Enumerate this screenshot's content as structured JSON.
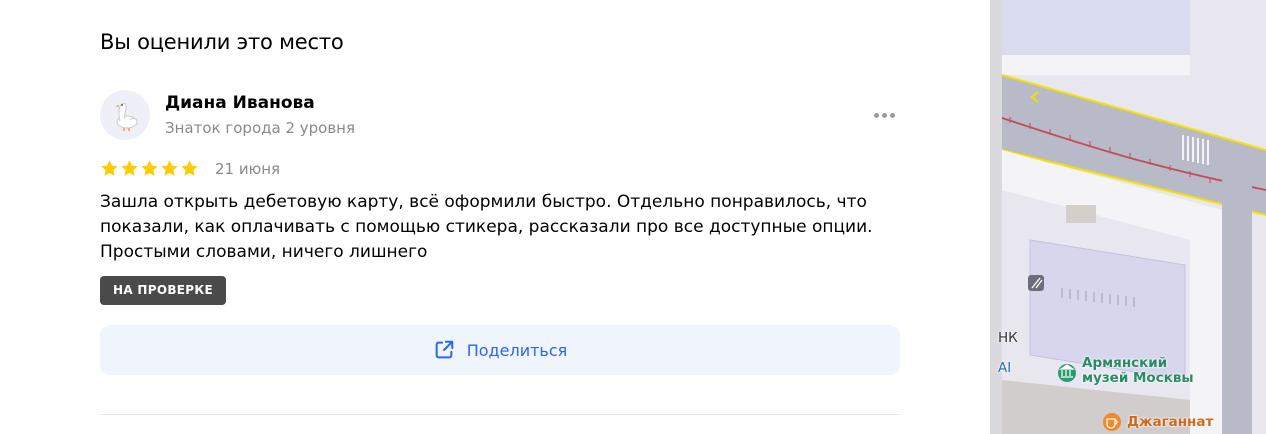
{
  "section": {
    "title": "Вы оценили это место"
  },
  "author": {
    "name": "Диана Иванова",
    "level": "Знаток города 2 уровня"
  },
  "review": {
    "rating": 5,
    "date": "21 июня",
    "text": "Зашла открыть дебетовую карту, всё оформили быстро. Отдельно понравилось, что показали, как оплачивать с помощью стикера, рассказали про все доступные опции. Простыми словами, ничего лишнего",
    "status": "НА ПРОВЕРКЕ"
  },
  "share": {
    "label": "Поделиться"
  },
  "map": {
    "edge_label_1": "НК",
    "edge_label_2": "AI",
    "poi_museum": "Армянский музей Москвы",
    "poi_cafe": "Джаганнат"
  },
  "colors": {
    "accent": "#2c66ee",
    "star": "#fccc00",
    "badge": "#4a4a4a",
    "share_bg": "#f0f4fd"
  },
  "icons": {
    "avatar": "goose-avatar",
    "more": "more-dots-icon",
    "share": "share-external-icon",
    "museum": "museum-icon",
    "cafe": "cafe-icon",
    "tram": "tram-icon"
  }
}
